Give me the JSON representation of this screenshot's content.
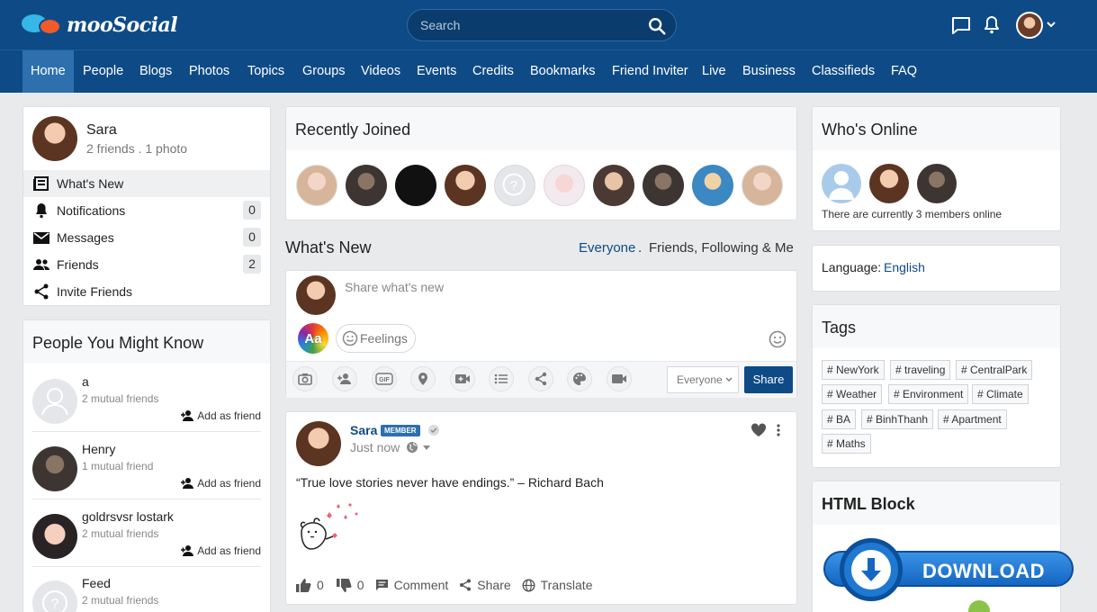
{
  "brand": {
    "name": "mooSocial"
  },
  "search": {
    "placeholder": "Search"
  },
  "nav": [
    "Home",
    "People",
    "Blogs",
    "Photos",
    "Topics",
    "Groups",
    "Videos",
    "Events",
    "Credits",
    "Bookmarks",
    "Friend Inviter",
    "Live",
    "Business",
    "Classifieds",
    "FAQ"
  ],
  "profile": {
    "name": "Sara",
    "stats": "2 friends . 1 photo"
  },
  "menu": {
    "whats_new": "What's New",
    "notifications": "Notifications",
    "notifications_count": "0",
    "messages": "Messages",
    "messages_count": "0",
    "friends": "Friends",
    "friends_count": "2",
    "invite": "Invite Friends"
  },
  "pymk": {
    "title": "People You Might Know",
    "add_label": "Add as friend",
    "people": [
      {
        "name": "a",
        "mutual": "2 mutual friends"
      },
      {
        "name": "Henry",
        "mutual": "1 mutual friend"
      },
      {
        "name": "goldrsvsr lostark",
        "mutual": "2 mutual friends"
      },
      {
        "name": "Feed",
        "mutual": "2 mutual friends"
      }
    ]
  },
  "recently_joined": {
    "title": "Recently Joined"
  },
  "whats_new": {
    "title": "What's New",
    "filter_active": "Everyone",
    "filter_sep": ".",
    "filter_other": "Friends, Following & Me",
    "composer_placeholder": "Share what's new",
    "aa_label": "Aa",
    "feelings_label": "Feelings",
    "privacy_value": "Everyone",
    "share_button": "Share"
  },
  "post": {
    "author": "Sara",
    "badge": "MEMBER",
    "time": "Just now",
    "text": "“True love stories never have endings.” – Richard Bach",
    "likes": "0",
    "dislikes": "0",
    "comment_label": "Comment",
    "share_label": "Share",
    "translate_label": "Translate"
  },
  "whos_online": {
    "title": "Who's Online",
    "summary": "There are currently 3 members online"
  },
  "language": {
    "label": "Language:",
    "value": "English"
  },
  "tags": {
    "title": "Tags",
    "items": [
      "# NewYork",
      "# traveling",
      "# CentralPark",
      "# Weather",
      "# Environment",
      "# Climate",
      "# BA",
      "# BinhThanh",
      "# Apartment",
      "# Maths"
    ]
  },
  "html_block": {
    "title": "HTML Block",
    "download_label": "DOWNLOAD"
  },
  "colors": {
    "header": "#0e4b86",
    "nav_active": "#2e6fae",
    "accent": "#0e4b86",
    "download_blue": "#1f78d1"
  }
}
